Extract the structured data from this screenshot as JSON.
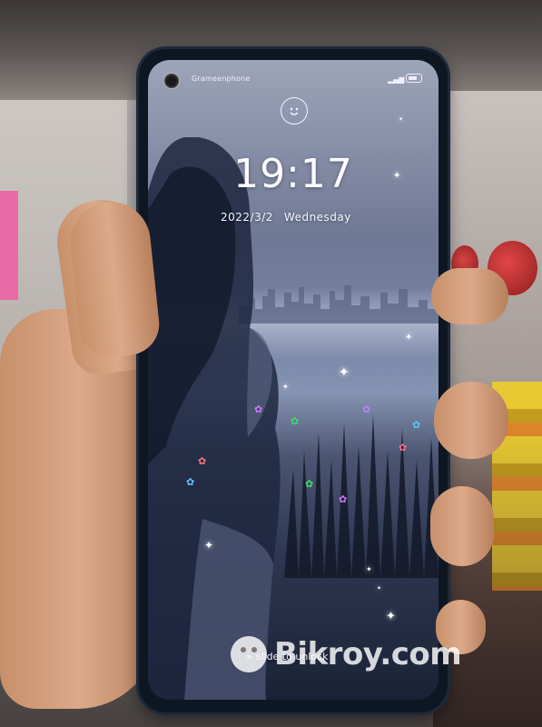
{
  "status_bar": {
    "carrier": "Grameenphone",
    "signal_icon": "signal-icon",
    "battery_icon": "battery-icon"
  },
  "lockscreen": {
    "time": "19:17",
    "date": "2022/3/2",
    "weekday": "Wednesday",
    "face_unlock_icon": "face-unlock-icon",
    "slide_hint": "slide to unlock",
    "slide_icon": "double-chevron-right-icon"
  },
  "watermark": {
    "text": "Bikroy.com"
  }
}
